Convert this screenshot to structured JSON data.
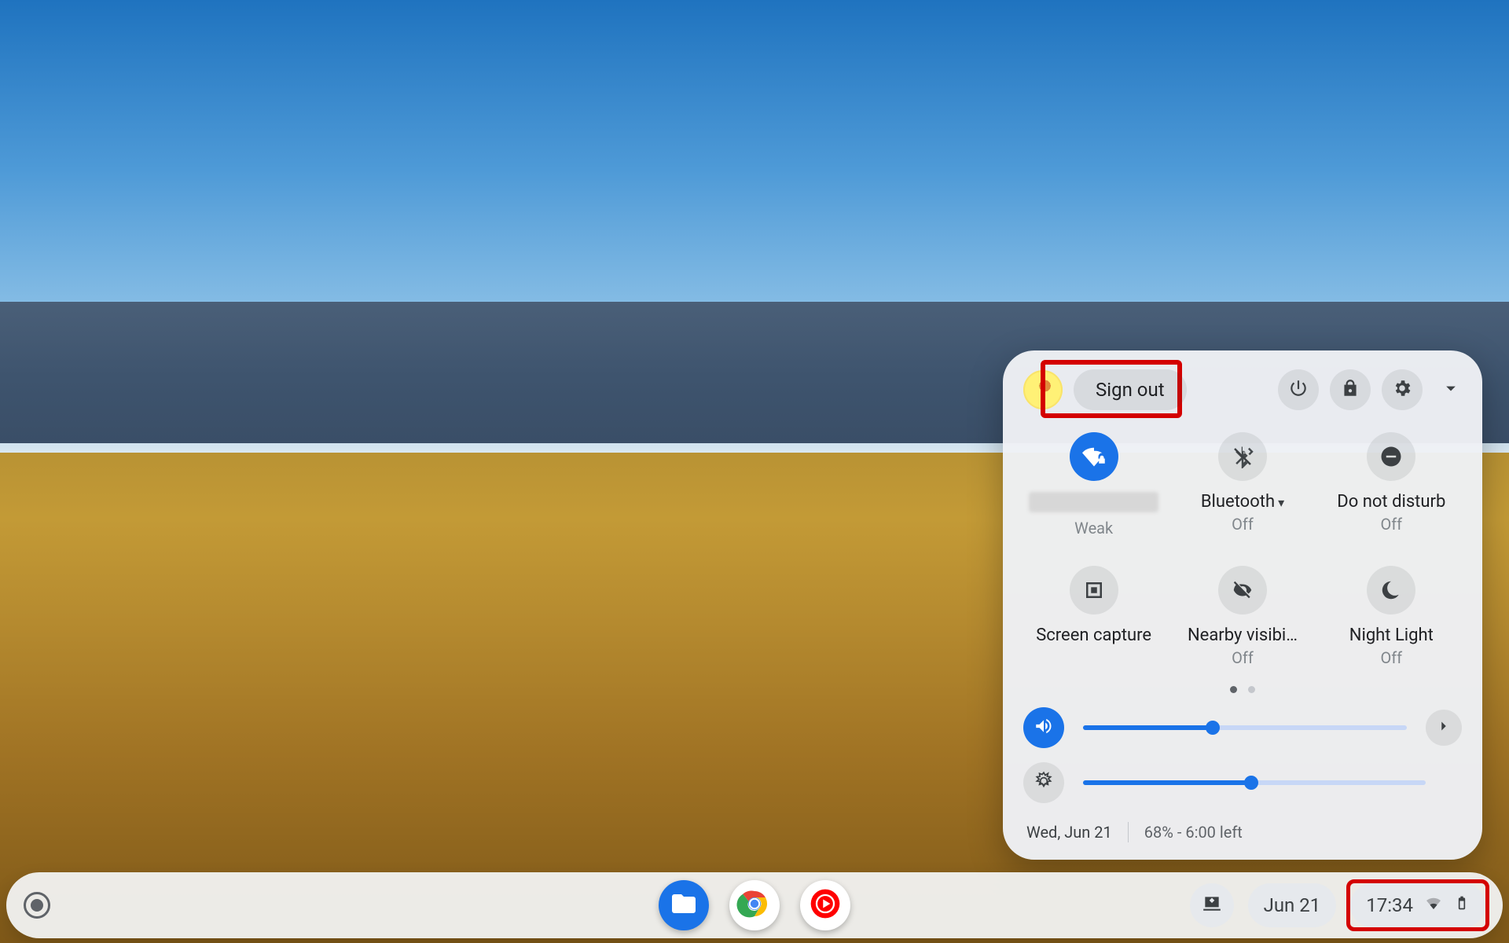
{
  "panel": {
    "sign_out_label": "Sign out",
    "tiles": [
      {
        "label": "████████",
        "sub": "Weak",
        "active": true,
        "icon": "wifi-lock"
      },
      {
        "label": "Bluetooth",
        "sub": "Off",
        "active": false,
        "icon": "bluetooth-off",
        "caret": true
      },
      {
        "label": "Do not disturb",
        "sub": "Off",
        "active": false,
        "icon": "dnd"
      },
      {
        "label": "Screen capture",
        "sub": "",
        "active": false,
        "icon": "screen-capture"
      },
      {
        "label": "Nearby visibi…",
        "sub": "Off",
        "active": false,
        "icon": "visibility-off"
      },
      {
        "label": "Night Light",
        "sub": "Off",
        "active": false,
        "icon": "night-light"
      }
    ],
    "pager": {
      "count": 2,
      "active": 0
    },
    "volume_percent": 40,
    "brightness_percent": 49,
    "footer_date": "Wed, Jun 21",
    "footer_battery": "68% - 6:00 left"
  },
  "shelf": {
    "date": "Jun 21",
    "time": "17:34"
  }
}
